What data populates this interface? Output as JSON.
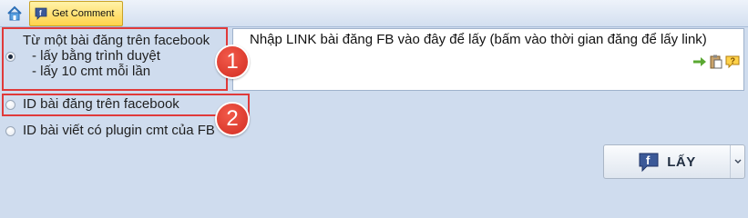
{
  "toolbar": {
    "home_icon": "home-icon",
    "get_comment_label": "Get Comment",
    "get_comment_icon": "facebook-comment-icon"
  },
  "options": [
    {
      "line1": "Từ một bài đăng trên facebook",
      "line2": "- lấy bằng trình duyệt",
      "line3": "- lấy 10 cmt mỗi lần",
      "checked": true
    },
    {
      "label": "ID bài đăng trên facebook",
      "checked": false
    },
    {
      "label": "ID bài viết có plugin cmt của FB",
      "checked": false
    }
  ],
  "link_box": {
    "text": "Nhập LINK bài đăng FB vào đây để lấy (bấm vào thời gian đăng để lấy link)",
    "icons": [
      "arrow-right-icon",
      "paste-icon",
      "help-icon"
    ]
  },
  "badges": [
    "1",
    "2"
  ],
  "action": {
    "label": "LẤY",
    "icon": "facebook-icon",
    "dropdown_icon": "chevron-down-icon"
  },
  "colors": {
    "highlight": "#e03a3a",
    "background": "#cfdcee",
    "get_comment_bg": "#ffd34a"
  }
}
